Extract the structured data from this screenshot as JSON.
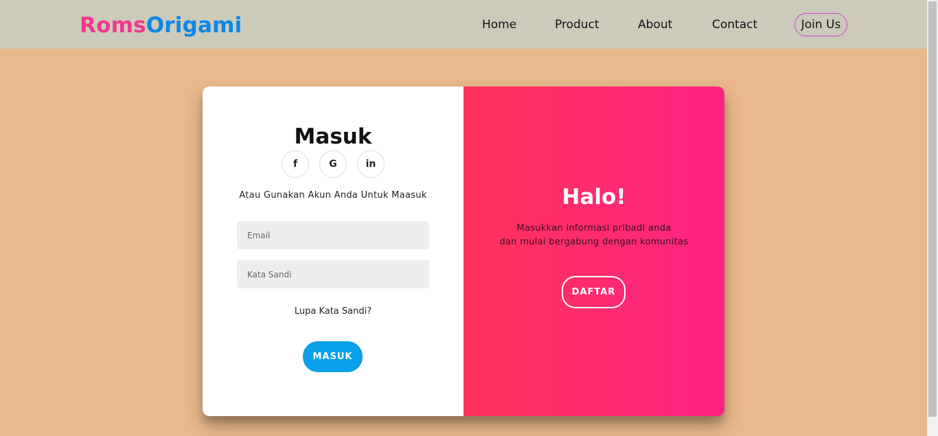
{
  "brand": {
    "part1": "Roms",
    "part2": "Origami"
  },
  "nav": {
    "items": [
      {
        "label": "Home"
      },
      {
        "label": "Product"
      },
      {
        "label": "About"
      },
      {
        "label": "Contact"
      }
    ],
    "join_label": "Join Us"
  },
  "login": {
    "title": "Masuk",
    "socials": [
      {
        "icon": "facebook-icon",
        "glyph": "f"
      },
      {
        "icon": "google-icon",
        "glyph": "G"
      },
      {
        "icon": "linkedin-icon",
        "glyph": "in"
      }
    ],
    "subtitle": "Atau Gunakan Akun Anda Untuk Maasuk",
    "email_placeholder": "Email",
    "password_placeholder": "Kata Sandi",
    "forgot_label": "Lupa Kata Sandi?",
    "submit_label": "MASUK"
  },
  "overlay": {
    "title": "Halo!",
    "line1": "Masukkan informasi pribadi anda",
    "line2": "dan mulai bergabung dengan komunitas",
    "button_label": "DAFTAR"
  },
  "colors": {
    "brand_pink": "#f0378f",
    "brand_blue": "#0b87e8",
    "page_bg": "#e9b98b",
    "navbar_bg": "#cccbba",
    "primary_button": "#0aa0e9",
    "gradient_start": "#ff3358",
    "gradient_end": "#ff2384"
  }
}
